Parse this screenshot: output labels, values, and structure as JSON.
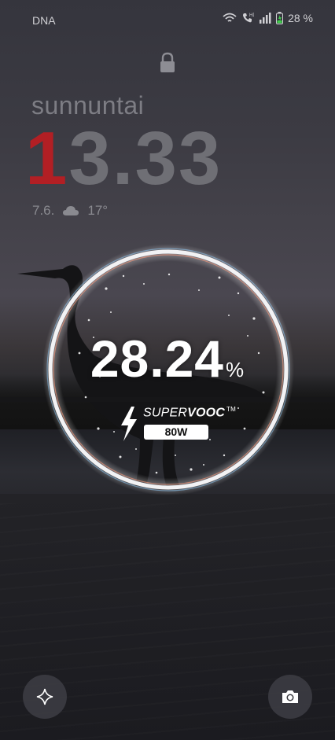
{
  "status_bar": {
    "carrier": "DNA",
    "battery_percent": "28 %"
  },
  "lock_screen": {
    "day": "sunnuntai",
    "time_first_digit": "1",
    "time_rest": "3.33",
    "date": "7.6.",
    "temperature": "17°"
  },
  "charging": {
    "level": "28.24",
    "unit": "%",
    "brand_regular": "SUPER",
    "brand_bold": "VOOC",
    "brand_tm": "TM",
    "wattage": "80W"
  },
  "icons": {
    "lock": "lock-icon",
    "wifi": "wifi-icon",
    "call": "call-icon",
    "signal": "signal-icon",
    "battery": "battery-charging-icon",
    "cloud": "cloud-icon",
    "bolt": "lightning-icon",
    "assistant": "sparkle-icon",
    "camera": "camera-icon"
  },
  "colors": {
    "time_accent": "#b21f24",
    "ring": "#ffffff"
  }
}
